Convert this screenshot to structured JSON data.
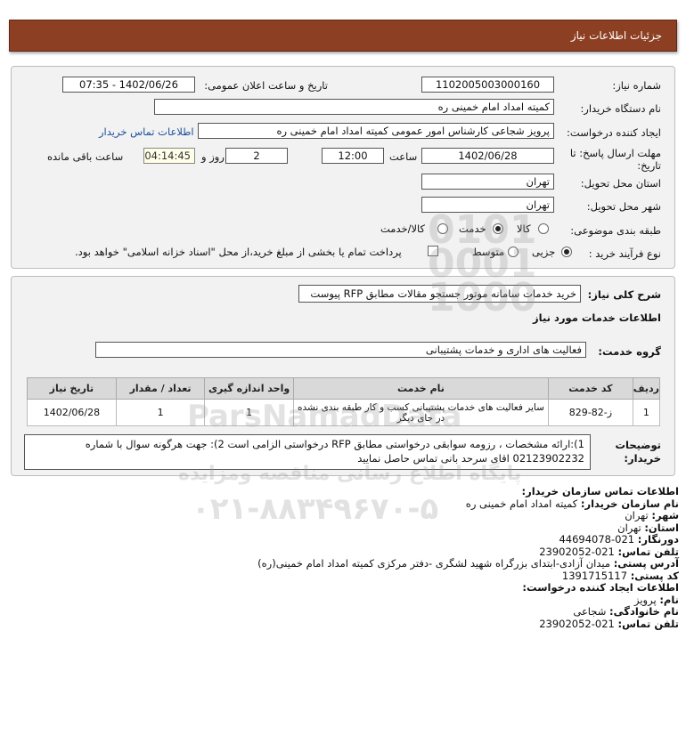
{
  "header": {
    "title": "جزئیات اطلاعات نیاز"
  },
  "form": {
    "need_number_label": "شماره نیاز:",
    "need_number": "1102005003000160",
    "announce_label": "تاریخ و ساعت اعلان عمومی:",
    "announce_value": "1402/06/26 - 07:35",
    "buyer_org_label": "نام دستگاه خریدار:",
    "buyer_org": "کمیته امداد امام خمینی ره",
    "creator_label": "ایجاد کننده درخواست:",
    "creator": "پرویز شجاعی کارشناس امور عمومی کمیته امداد امام خمینی ره",
    "buyer_contact_link": "اطلاعات تماس خریدار",
    "deadline_label_1": "مهلت ارسال پاسخ: تا",
    "deadline_label_2": "تاریخ:",
    "deadline_date": "1402/06/28",
    "time_label": "ساعت",
    "deadline_time": "12:00",
    "days_value": "2",
    "days_label": "روز و",
    "remaining_time": "04:14:45",
    "remaining_label": "ساعت باقی مانده",
    "province_label": "استان محل تحویل:",
    "province": "تهران",
    "city_label": "شهر محل تحویل:",
    "city": "تهران",
    "category_label": "طبقه بندی موضوعی:",
    "category_options": [
      "کالا",
      "خدمت",
      "کالا/خدمت"
    ],
    "category_selected": "خدمت",
    "process_label": "نوع فرآیند خرید :",
    "process_options": [
      "جزیی",
      "متوسط"
    ],
    "process_selected": "جزیی",
    "payment_note": "پرداخت تمام یا بخشی از مبلغ خرید،از محل \"اسناد خزانه اسلامی\" خواهد بود."
  },
  "summary": {
    "label": "شرح کلی نیاز:",
    "value": "خرید خدمات سامانه موتور جستجو مقالات مطابق RFP پیوست",
    "services_heading": "اطلاعات خدمات مورد نیاز",
    "service_group_label": "گروه خدمت:",
    "service_group": "فعالیت های اداری و خدمات پشتیبانی"
  },
  "table": {
    "headers": [
      "ردیف",
      "کد خدمت",
      "نام خدمت",
      "واحد اندازه گیری",
      "تعداد / مقدار",
      "تاریخ نیاز"
    ],
    "rows": [
      {
        "row": "1",
        "code": "ز-82-829",
        "name": "سایر فعالیت های خدمات پشتیبانی کسب و کار طبقه بندی نشده در جای دیگر",
        "unit": "1",
        "qty": "1",
        "date": "1402/06/28"
      }
    ]
  },
  "notes": {
    "label_1": "توضیحات",
    "label_2": "خریدار:",
    "line_1": "1):ارائه مشخصات ، رزومه سوابقی درخواستی مطابق RFP درخواستی الزامی است 2): جهت هرگونه سوال با شماره",
    "line_2": "02123902232 اقای سرحد بانی تماس حاصل نمایید"
  },
  "contact": {
    "org_heading": "اطلاعات تماس سازمان خریدار:",
    "org_name_label": "نام سازمان خریدار:",
    "org_name": "کمیته امداد امام خمینی ره",
    "city_label": "شهر:",
    "city": "تهران",
    "province_label": "استان:",
    "province": "تهران",
    "fax_label": "دورنگار:",
    "fax": "021-44694078",
    "phone_label": "تلفن تماس:",
    "phone": "021-23902052",
    "address_label": "آدرس پستی:",
    "address": "میدان آزادی-ابتدای بزرگراه شهید لشگری -دفتر مرکزی کمیته امداد امام خمینی(ره)",
    "postal_label": "کد پستی:",
    "postal": "1391715117",
    "creator_heading": "اطلاعات ایجاد کننده درخواست:",
    "first_name_label": "نام:",
    "first_name": "پرویز",
    "last_name_label": "نام خانوادگی:",
    "last_name": "شجاعی",
    "creator_phone_label": "تلفن تماس:",
    "creator_phone": "021-23902052"
  },
  "watermark": {
    "line_1": "ParsNamadData",
    "line_2": "پایگاه اطلاع رسانی مناقصه ومزایده",
    "line_3": "۰۲۱-۸۸۳۴۹۶۷۰-۵",
    "color": "#969696"
  },
  "colors": {
    "title_bg": "#8c3f22",
    "link": "#1b4f9c",
    "panel_bg": "#f2f2f2"
  }
}
